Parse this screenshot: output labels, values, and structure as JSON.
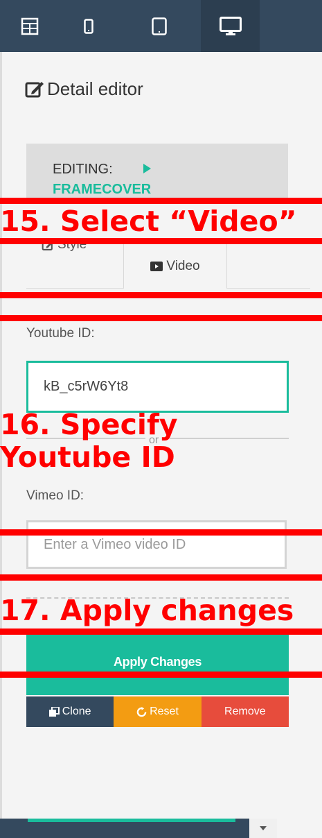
{
  "toolbar": {
    "buttons": [
      {
        "icon": "grid-layout-icon"
      },
      {
        "icon": "mobile-device-icon"
      },
      {
        "icon": "tablet-device-icon"
      },
      {
        "icon": "desktop-device-icon",
        "active": true
      }
    ]
  },
  "detail_editor": {
    "title": "Detail editor",
    "title_icon": "edit-icon",
    "editing_label": "EDITING:",
    "editing_name": "FRAMECOVER"
  },
  "tabs": [
    {
      "label": "Style",
      "icon": "edit-icon"
    },
    {
      "label": "Video",
      "icon": "video-icon",
      "active": true
    }
  ],
  "youtube": {
    "label": "Youtube ID:",
    "value": "kB_c5rW6Yt8"
  },
  "separator_text": "or",
  "vimeo": {
    "label": "Vimeo ID:",
    "value": "",
    "placeholder": "Enter a Vimeo video ID"
  },
  "actions": {
    "apply": "Apply Changes",
    "clone": "Clone",
    "reset": "Reset",
    "remove": "Remove"
  },
  "annotations": {
    "step15": "15. Select “Video”",
    "step16_line1": "16. Specify",
    "step16_line2": "Youtube ID",
    "step17": "17. Apply changes"
  },
  "colors": {
    "toolbar_bg": "#34495e",
    "accent_green": "#1abc9c",
    "reset_orange": "#f39c12",
    "remove_red": "#e74c3c",
    "annotation_red": "#ff0000"
  }
}
